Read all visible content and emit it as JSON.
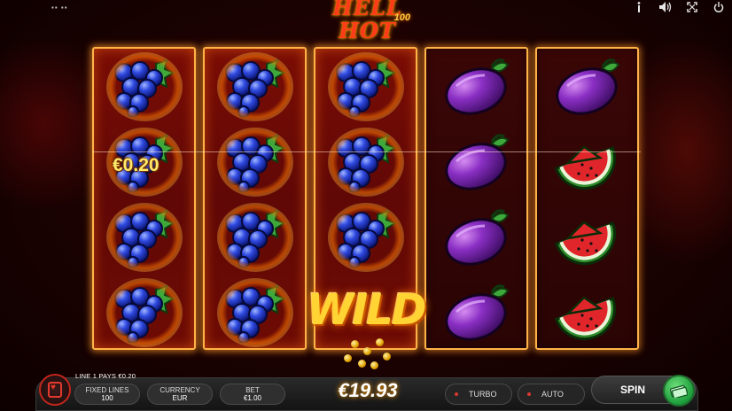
{
  "logo": {
    "main": "HELL HOT",
    "sub": "100"
  },
  "top_bar": {
    "left_icon": "menu-dots-icon",
    "icons": [
      "info-icon",
      "sound-icon",
      "fullscreen-icon",
      "power-icon"
    ]
  },
  "reels": [
    [
      "grapes",
      "grapes",
      "grapes",
      "grapes"
    ],
    [
      "grapes",
      "grapes",
      "grapes",
      "grapes"
    ],
    [
      "grapes",
      "grapes",
      "grapes",
      "wild"
    ],
    [
      "plum",
      "plum",
      "plum",
      "plum"
    ],
    [
      "plum",
      "watermelon",
      "watermelon",
      "watermelon"
    ]
  ],
  "win": {
    "amount": "€0.20",
    "line_text": "LINE 1 PAYS €0.20"
  },
  "wild_label": "WILD",
  "controls": {
    "fixed_lines_title": "FIXED LINES",
    "fixed_lines_value": "100",
    "currency_title": "CURRENCY",
    "currency_value": "EUR",
    "bet_title": "BET",
    "bet_value": "€1.00",
    "balance": "€19.93",
    "turbo": "TURBO",
    "auto": "AUTO",
    "spin": "SPIN"
  },
  "colors": {
    "accent": "#ffb347",
    "reel_bg": "#6a0b05",
    "win_text": "#ffe96b",
    "spin_green": "#1b9c3a"
  }
}
